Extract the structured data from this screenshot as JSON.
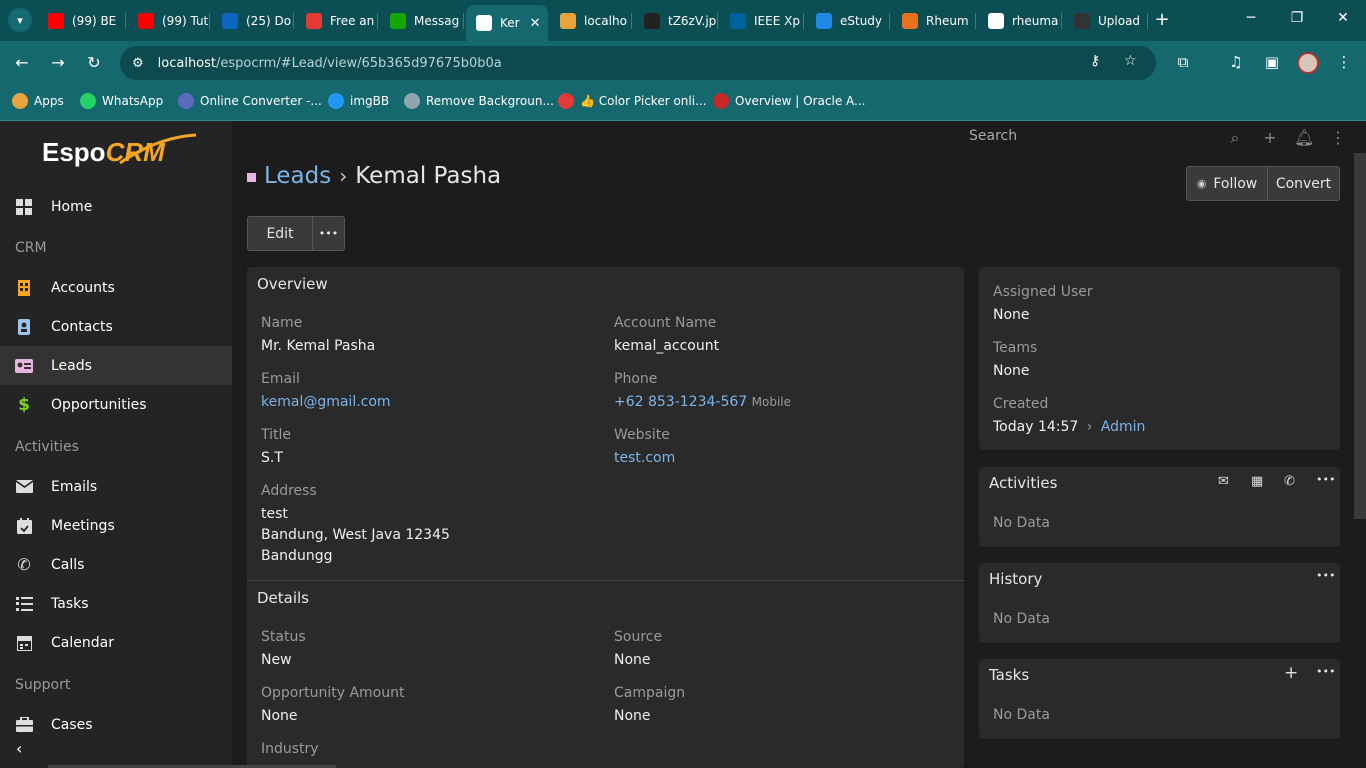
{
  "browser": {
    "tabs": [
      {
        "label": "(99) BE",
        "icon": "youtube-icon",
        "color": "#ff0000"
      },
      {
        "label": "(99) Tut",
        "icon": "youtube-icon",
        "color": "#ff0000"
      },
      {
        "label": "(25) Do",
        "icon": "linkedin-icon",
        "color": "#0a66c2"
      },
      {
        "label": "Free an",
        "icon": "e-icon",
        "color": "#e53935"
      },
      {
        "label": "Messag",
        "icon": "upwork-icon",
        "color": "#14a800"
      },
      {
        "label": "Ker",
        "icon": "espo-icon",
        "color": "#ffffff",
        "active": true
      },
      {
        "label": "localho",
        "icon": "mountain-icon",
        "color": "#e8a33d"
      },
      {
        "label": "tZ6zV.jp",
        "icon": "i-icon",
        "color": "#222222"
      },
      {
        "label": "IEEE Xp",
        "icon": "ieee-icon",
        "color": "#00629b"
      },
      {
        "label": "eStudy",
        "icon": "estudy-icon",
        "color": "#1e88e5"
      },
      {
        "label": "Rheum",
        "icon": "elsevier-icon",
        "color": "#e9711c"
      },
      {
        "label": "rheuma",
        "icon": "google-icon",
        "color": "#ffffff"
      },
      {
        "label": "Upload",
        "icon": "github-icon",
        "color": "#333333"
      }
    ],
    "url_host": "localhost",
    "url_path": "/espocrm/#Lead/view/65b365d97675b0b0a",
    "bookmarks": [
      {
        "label": "Apps",
        "icon": "apps-grid-icon",
        "color": "#e8a33d"
      },
      {
        "label": "WhatsApp",
        "icon": "whatsapp-icon",
        "color": "#25d366"
      },
      {
        "label": "Online Converter -...",
        "icon": "converter-icon",
        "color": "#5c6bc0"
      },
      {
        "label": "imgBB",
        "icon": "imgbb-icon",
        "color": "#2196f3"
      },
      {
        "label": "Remove Backgroun...",
        "icon": "remove-bg-icon",
        "color": "#90a4ae"
      },
      {
        "label": "👍 Color Picker onli...",
        "icon": "color-picker-icon",
        "color": "#e53935"
      },
      {
        "label": "Overview | Oracle A...",
        "icon": "oracle-icon",
        "color": "#c62828"
      }
    ]
  },
  "app": {
    "logo_text_1": "Espo",
    "logo_text_2": "CRM",
    "search_placeholder": "Search",
    "nav": {
      "home": "Home",
      "group_crm": "CRM",
      "accounts": "Accounts",
      "contacts": "Contacts",
      "leads": "Leads",
      "opportunities": "Opportunities",
      "group_activities": "Activities",
      "emails": "Emails",
      "meetings": "Meetings",
      "calls": "Calls",
      "tasks": "Tasks",
      "calendar": "Calendar",
      "group_support": "Support",
      "cases": "Cases"
    }
  },
  "record": {
    "breadcrumb_parent": "Leads",
    "breadcrumb_sep": "›",
    "title": "Kemal Pasha",
    "follow_label": "Follow",
    "convert_label": "Convert",
    "edit_label": "Edit",
    "more_label": "•••",
    "overview": {
      "title": "Overview",
      "name_label": "Name",
      "name_value": "Mr. Kemal Pasha",
      "account_label": "Account Name",
      "account_value": "kemal_account",
      "email_label": "Email",
      "email_value": "kemal@gmail.com",
      "phone_label": "Phone",
      "phone_value": "+62 853-1234-567",
      "phone_type": "Mobile",
      "title_label": "Title",
      "title_value": "S.T",
      "website_label": "Website",
      "website_value": "test.com",
      "address_label": "Address",
      "address_line1": "test",
      "address_line2": "Bandung, West Java 12345",
      "address_line3": "Bandungg"
    },
    "details": {
      "title": "Details",
      "status_label": "Status",
      "status_value": "New",
      "source_label": "Source",
      "source_value": "None",
      "opp_amount_label": "Opportunity Amount",
      "opp_amount_value": "None",
      "campaign_label": "Campaign",
      "campaign_value": "None",
      "industry_label": "Industry"
    },
    "side": {
      "assigned_label": "Assigned User",
      "assigned_value": "None",
      "teams_label": "Teams",
      "teams_value": "None",
      "created_label": "Created",
      "created_value": "Today 14:57",
      "created_sep": "›",
      "created_by": "Admin"
    },
    "activities": {
      "title": "Activities",
      "empty": "No Data"
    },
    "history": {
      "title": "History",
      "empty": "No Data"
    },
    "tasks": {
      "title": "Tasks",
      "empty": "No Data"
    }
  }
}
